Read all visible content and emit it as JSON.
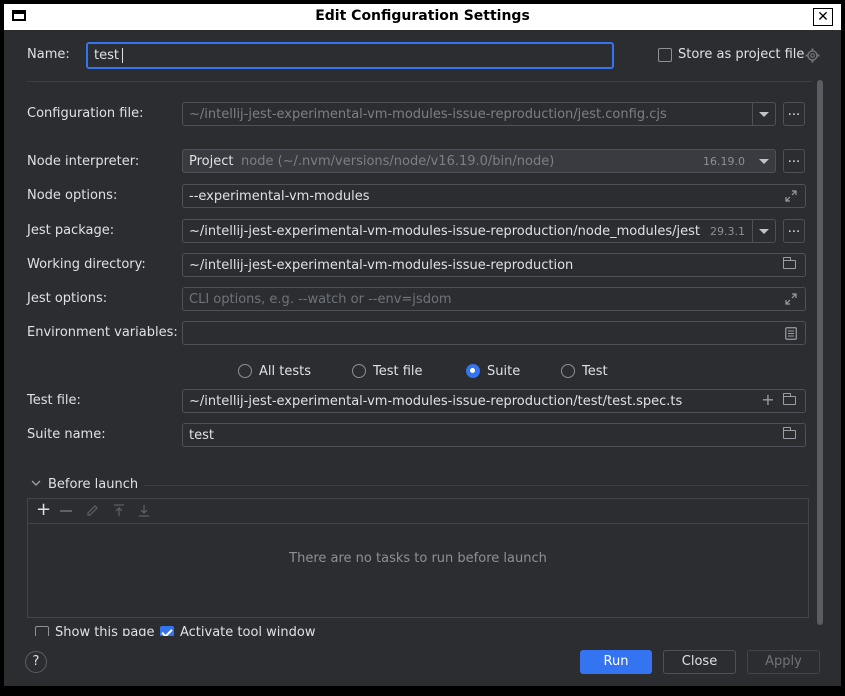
{
  "window": {
    "title": "Edit Configuration Settings",
    "close_glyph": "✕"
  },
  "name": {
    "label": "Name:",
    "value": "test"
  },
  "store_as_project_file": {
    "label": "Store as project file",
    "checked": false
  },
  "config_file": {
    "label": "Configuration file:",
    "value": "~/intellij-jest-experimental-vm-modules-issue-reproduction/jest.config.cjs"
  },
  "node_interpreter": {
    "label": "Node interpreter:",
    "prefix": "Project",
    "value": "node (~/.nvm/versions/node/v16.19.0/bin/node)",
    "version": "16.19.0"
  },
  "node_options": {
    "label": "Node options:",
    "value": "--experimental-vm-modules"
  },
  "jest_package": {
    "label": "Jest package:",
    "value": "~/intellij-jest-experimental-vm-modules-issue-reproduction/node_modules/jest",
    "version": "29.3.1"
  },
  "working_directory": {
    "label": "Working directory:",
    "value": "~/intellij-jest-experimental-vm-modules-issue-reproduction"
  },
  "jest_options": {
    "label": "Jest options:",
    "placeholder": "CLI options, e.g. --watch or --env=jsdom"
  },
  "env_vars": {
    "label": "Environment variables:",
    "value": ""
  },
  "scope": {
    "options": [
      "All tests",
      "Test file",
      "Suite",
      "Test"
    ],
    "selected": "Suite"
  },
  "test_file": {
    "label": "Test file:",
    "value": "~/intellij-jest-experimental-vm-modules-issue-reproduction/test/test.spec.ts"
  },
  "suite_name": {
    "label": "Suite name:",
    "value": "test"
  },
  "before_launch": {
    "label": "Before launch",
    "empty_text": "There are no tasks to run before launch"
  },
  "show_this_page": {
    "label": "Show this page",
    "checked": false
  },
  "activate_tool_window": {
    "label": "Activate tool window",
    "checked": true
  },
  "buttons": {
    "help": "?",
    "run": "Run",
    "close": "Close",
    "apply": "Apply",
    "more": "..."
  },
  "colors": {
    "accent": "#3574f0",
    "background": "#2b2d30",
    "text": "#dfe1e5"
  }
}
